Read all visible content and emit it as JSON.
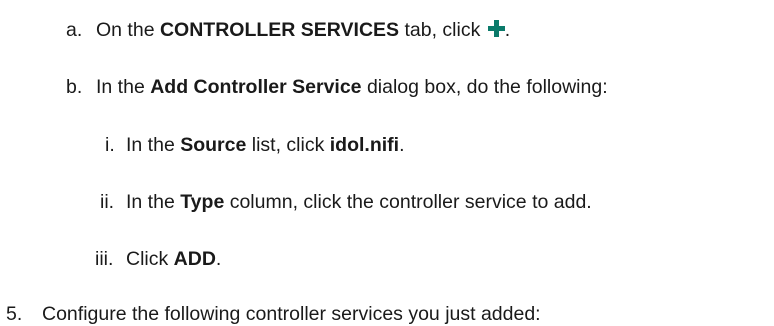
{
  "steps": {
    "a": {
      "marker": "a.",
      "pre": "On the ",
      "bold": "CONTROLLER SERVICES",
      "post": " tab, click ",
      "icon": "plus-icon",
      "icon_color": "#0a7a6a",
      "end": "."
    },
    "b": {
      "marker": "b.",
      "pre": "In the ",
      "bold": "Add Controller Service",
      "post": " dialog box, do the following:"
    },
    "i": {
      "marker": "i.",
      "pre": "In the ",
      "bold": "Source",
      "mid": " list, click ",
      "bold2": "idol.nifi",
      "end": "."
    },
    "ii": {
      "marker": "ii.",
      "pre": "In the ",
      "bold": "Type",
      "post": " column, click the controller service to add."
    },
    "iii": {
      "marker": "iii.",
      "pre": "Click ",
      "bold": "ADD",
      "end": "."
    },
    "five": {
      "marker": "5.",
      "text": "Configure the following controller services you just added:"
    }
  }
}
